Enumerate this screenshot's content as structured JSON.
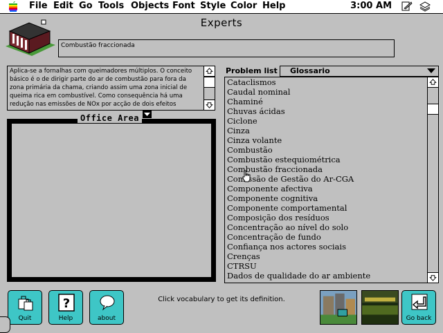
{
  "menubar": {
    "apple_icon": "apple-logo-icon",
    "menus": [
      "File",
      "Edit",
      "Go",
      "Tools",
      "Objects",
      "Font",
      "Style",
      "Color",
      "Help"
    ],
    "clock": "3:00 AM"
  },
  "window": {
    "title": "Experts"
  },
  "selected_term": "Combustão fraccionada",
  "definition": "Aplica-se a fornalhas com queimadores múltiplos. O conceito básico é o de dirigir parte do ar de combustão para fora da zona primária da chama, criando assim uma zona inicial de queima rica em combustível. Como consequência há uma redução nas emissões de NOx por acção de dois efeitos",
  "office": {
    "label": "Office Area"
  },
  "problem_list": {
    "label": "Problem list",
    "selected": "Glossario",
    "items": [
      "Cataclismos",
      "Caudal nominal",
      "Chaminé",
      "Chuvas ácidas",
      "Ciclone",
      "Cinza",
      "Cinza volante",
      "Combustão",
      "Combustão estequiométrica",
      "Combustão fraccionada",
      "Comissão de Gestão do Ar-CGA",
      "Componente afectiva",
      "Componente cognitiva",
      "Componente comportamental",
      "Composição dos resíduos",
      "Concentração ao nível do solo",
      "Concentração de fundo",
      "Confiança nos actores sociais",
      "Crenças",
      "CTRSU",
      "Dados de qualidade do ar ambiente"
    ]
  },
  "buttons": {
    "quit": "Quit",
    "help": "Help",
    "about": "about",
    "go_back": "Go back"
  },
  "status": "Click vocabulary to get its definition.",
  "colors": {
    "button": "#3ec6c6",
    "background": "#c0c0c0"
  }
}
